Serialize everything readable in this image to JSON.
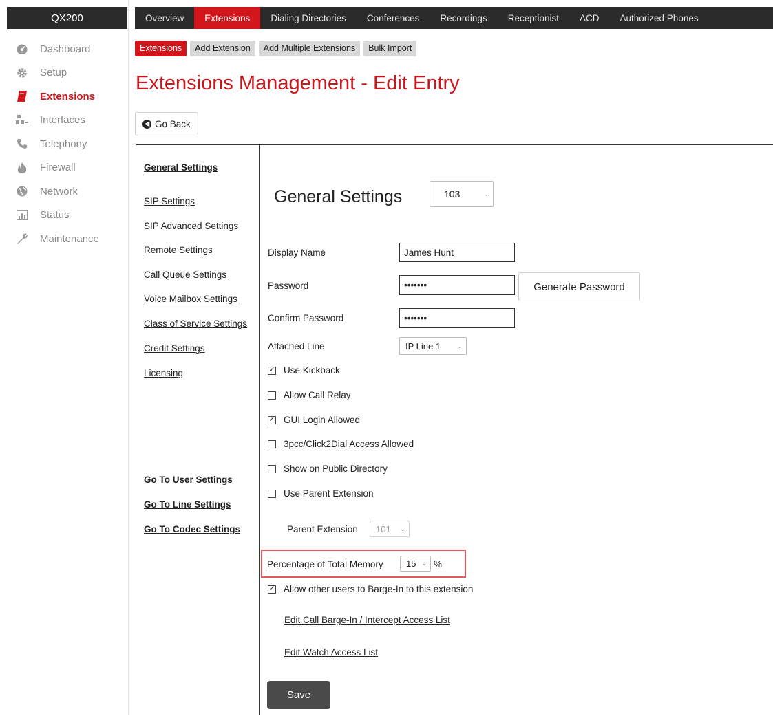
{
  "app": {
    "brand": "QX200"
  },
  "sidebar": {
    "items": [
      {
        "label": "Dashboard",
        "icon": "dashboard-icon"
      },
      {
        "label": "Setup",
        "icon": "gear-icon"
      },
      {
        "label": "Extensions",
        "icon": "book-icon",
        "active": true
      },
      {
        "label": "Interfaces",
        "icon": "interfaces-icon"
      },
      {
        "label": "Telephony",
        "icon": "phone-icon"
      },
      {
        "label": "Firewall",
        "icon": "fire-icon"
      },
      {
        "label": "Network",
        "icon": "globe-icon"
      },
      {
        "label": "Status",
        "icon": "bar-chart-icon"
      },
      {
        "label": "Maintenance",
        "icon": "wrench-icon"
      }
    ]
  },
  "topnav": {
    "tabs": [
      {
        "label": "Overview"
      },
      {
        "label": "Extensions",
        "active": true
      },
      {
        "label": "Dialing Directories"
      },
      {
        "label": "Conferences"
      },
      {
        "label": "Recordings"
      },
      {
        "label": "Receptionist"
      },
      {
        "label": "ACD"
      },
      {
        "label": "Authorized Phones"
      }
    ]
  },
  "subtabs": [
    {
      "label": "Extensions",
      "active": true
    },
    {
      "label": "Add Extension"
    },
    {
      "label": "Add Multiple Extensions"
    },
    {
      "label": "Bulk Import"
    }
  ],
  "page": {
    "title": "Extensions Management - Edit Entry",
    "go_back": "Go Back"
  },
  "settings_nav": {
    "items": [
      "General Settings",
      "SIP Settings",
      "SIP Advanced Settings",
      "Remote Settings",
      "Call Queue Settings",
      "Voice Mailbox Settings",
      "Class of Service Settings",
      "Credit Settings",
      "Licensing"
    ],
    "goto": [
      "Go To User Settings",
      "Go To Line Settings",
      "Go To Codec Settings"
    ]
  },
  "form": {
    "section_title": "General Settings",
    "extension_select": "103",
    "display_name_label": "Display Name",
    "display_name_value": "James Hunt",
    "password_label": "Password",
    "password_value": "•••••••",
    "generate_password": "Generate Password",
    "confirm_password_label": "Confirm Password",
    "confirm_password_value": "•••••••",
    "attached_line_label": "Attached Line",
    "attached_line_value": "IP Line 1",
    "checkboxes": [
      {
        "label": "Use Kickback",
        "checked": true
      },
      {
        "label": "Allow Call Relay",
        "checked": false
      },
      {
        "label": "GUI Login Allowed",
        "checked": true
      },
      {
        "label": "3pcc/Click2Dial Access Allowed",
        "checked": false
      },
      {
        "label": "Show on Public Directory",
        "checked": false
      },
      {
        "label": "Use Parent Extension",
        "checked": false
      }
    ],
    "parent_extension_label": "Parent Extension",
    "parent_extension_value": "101",
    "memory_label": "Percentage of Total Memory",
    "memory_value": "15",
    "memory_unit": "%",
    "barge_in_label": "Allow other users to Barge-In to this extension",
    "barge_in_checked": true,
    "links": [
      "Edit Call Barge-In / Intercept Access List",
      "Edit Watch Access List"
    ],
    "save": "Save"
  }
}
